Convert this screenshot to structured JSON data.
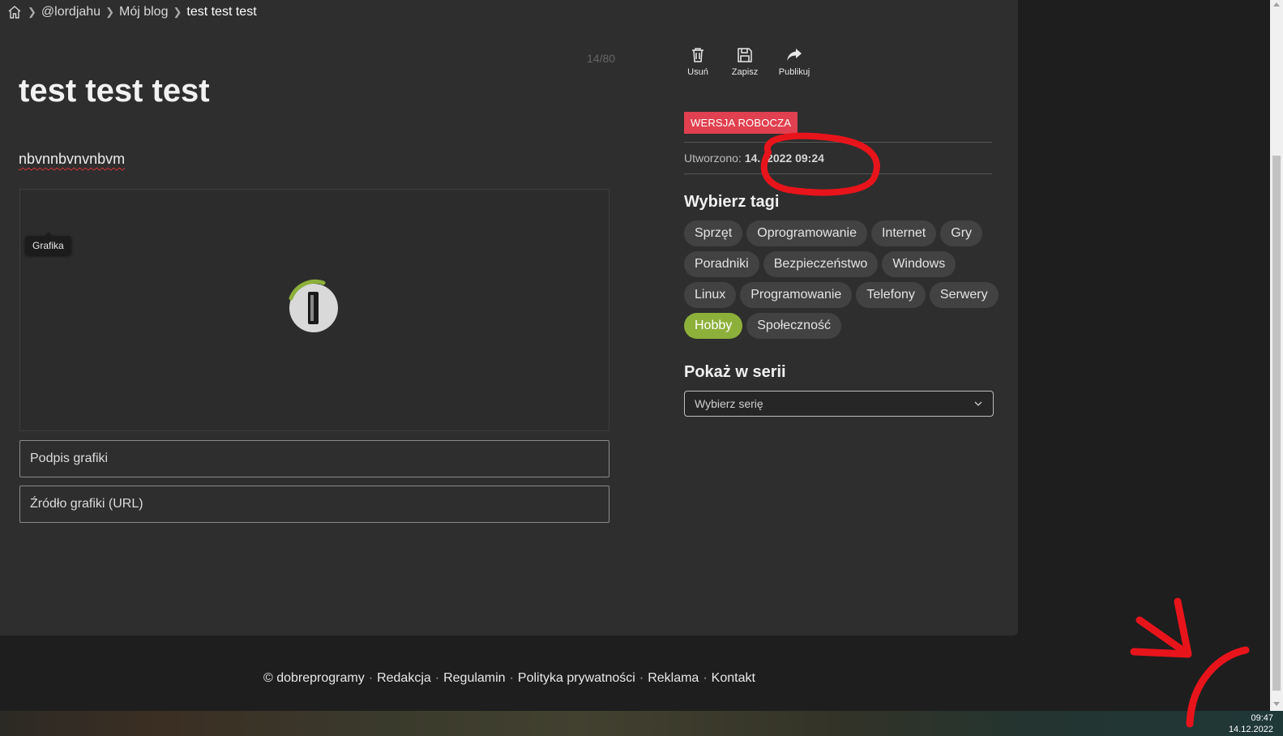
{
  "breadcrumb": {
    "items": [
      "@lordjahu",
      "Mój blog"
    ],
    "current": "test test test"
  },
  "editor": {
    "char_counter": "14/80",
    "title": "test test test",
    "lead": "nbvnnbvnvnbvm",
    "image_tooltip": "Grafika",
    "caption_placeholder": "Podpis grafiki",
    "source_placeholder": "Źródło grafiki (URL)"
  },
  "toolbar": {
    "delete_label": "Usuń",
    "save_label": "Zapisz",
    "publish_label": "Publikuj"
  },
  "sidebar": {
    "status_badge": "WERSJA ROBOCZA",
    "created_label": "Utworzono:",
    "created_value": "14.  .2022 09:24",
    "tags_heading": "Wybierz tagi",
    "tags": [
      {
        "label": "Sprzęt",
        "active": false
      },
      {
        "label": "Oprogramowanie",
        "active": false
      },
      {
        "label": "Internet",
        "active": false
      },
      {
        "label": "Gry",
        "active": false
      },
      {
        "label": "Poradniki",
        "active": false
      },
      {
        "label": "Bezpieczeństwo",
        "active": false
      },
      {
        "label": "Windows",
        "active": false
      },
      {
        "label": "Linux",
        "active": false
      },
      {
        "label": "Programowanie",
        "active": false
      },
      {
        "label": "Telefony",
        "active": false
      },
      {
        "label": "Serwery",
        "active": false
      },
      {
        "label": "Hobby",
        "active": true
      },
      {
        "label": "Społeczność",
        "active": false
      }
    ],
    "series_heading": "Pokaż w serii",
    "series_select": "Wybierz serię"
  },
  "footer": {
    "links": [
      "© dobreprogramy",
      "Redakcja",
      "Regulamin",
      "Polityka prywatności",
      "Reklama",
      "Kontakt"
    ]
  },
  "taskbar": {
    "time": "09:47",
    "date": "14.12.2022"
  },
  "colors": {
    "panel": "#2e2e2e",
    "page_bg": "#1e1e1e",
    "badge": "#e0404f",
    "tag_active": "#8db03a",
    "annotation": "#e8141b"
  }
}
